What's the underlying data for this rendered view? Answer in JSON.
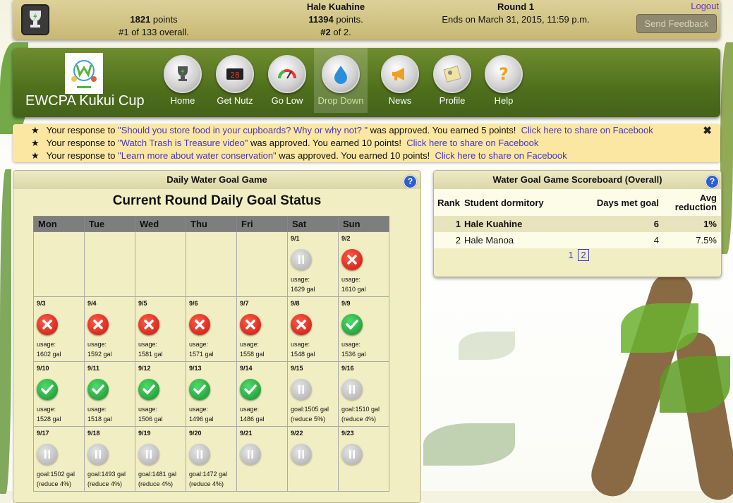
{
  "user": {
    "points": "1821",
    "points_label": "points",
    "rank_overall": "#1",
    "rank_overall_suffix": "of 133 overall."
  },
  "team": {
    "name": "Hale Kuahine",
    "points": "11394",
    "points_label": "points.",
    "rank": "#2",
    "rank_suffix": "of 2."
  },
  "round": {
    "title": "Round 1",
    "ends": "Ends on March 31, 2015, 11:59 p.m."
  },
  "header": {
    "logout": "Logout",
    "feedback": "Send Feedback"
  },
  "brand": {
    "name": "EWCPA Kukui Cup"
  },
  "nav": [
    {
      "label": "Home",
      "icon": "trophy-icon"
    },
    {
      "label": "Get Nutz",
      "icon": "scoreboard-icon"
    },
    {
      "label": "Go Low",
      "icon": "gauge-icon"
    },
    {
      "label": "Drop Down",
      "icon": "water-drop-icon"
    },
    {
      "label": "News",
      "icon": "megaphone-icon"
    },
    {
      "label": "Profile",
      "icon": "profile-card-icon"
    },
    {
      "label": "Help",
      "icon": "question-icon"
    }
  ],
  "notifications": [
    {
      "prefix": "Your response to",
      "link": "\"Should you store food in your cupboards? Why or why not? \"",
      "suffix": "was approved. You earned 5 points!",
      "share": "Click here to share on Facebook"
    },
    {
      "prefix": "Your response to",
      "link": "\"Watch Trash is Treasure video\"",
      "suffix": "was approved. You earned 10 points!",
      "share": "Click here to share on Facebook"
    },
    {
      "prefix": "Your response to",
      "link": "\"Learn more about water conservation\"",
      "suffix": "was approved. You earned 10 points!",
      "share": "Click here to share on Facebook"
    }
  ],
  "water_game": {
    "title": "Daily Water Goal Game",
    "heading": "Current Round Daily Goal Status",
    "days": [
      "Mon",
      "Tue",
      "Wed",
      "Thu",
      "Fri",
      "Sat",
      "Sun"
    ],
    "weeks": [
      [
        {
          "date": "",
          "status": "empty"
        },
        {
          "date": "",
          "status": "empty"
        },
        {
          "date": "",
          "status": "empty"
        },
        {
          "date": "",
          "status": "empty"
        },
        {
          "date": "",
          "status": "empty"
        },
        {
          "date": "9/1",
          "status": "pause",
          "l1": "usage:",
          "l2": "1629 gal"
        },
        {
          "date": "9/2",
          "status": "fail",
          "l1": "usage:",
          "l2": "1610 gal"
        }
      ],
      [
        {
          "date": "9/3",
          "status": "fail",
          "l1": "usage:",
          "l2": "1602 gal"
        },
        {
          "date": "9/4",
          "status": "fail",
          "l1": "usage:",
          "l2": "1592 gal"
        },
        {
          "date": "9/5",
          "status": "fail",
          "l1": "usage:",
          "l2": "1581 gal"
        },
        {
          "date": "9/6",
          "status": "fail",
          "l1": "usage:",
          "l2": "1571 gal"
        },
        {
          "date": "9/7",
          "status": "fail",
          "l1": "usage:",
          "l2": "1558 gal"
        },
        {
          "date": "9/8",
          "status": "fail",
          "l1": "usage:",
          "l2": "1548 gal"
        },
        {
          "date": "9/9",
          "status": "ok",
          "l1": "usage:",
          "l2": "1536 gal"
        }
      ],
      [
        {
          "date": "9/10",
          "status": "ok",
          "l1": "usage:",
          "l2": "1528 gal"
        },
        {
          "date": "9/11",
          "status": "ok",
          "l1": "usage:",
          "l2": "1518 gal"
        },
        {
          "date": "9/12",
          "status": "ok",
          "l1": "usage:",
          "l2": "1506 gal"
        },
        {
          "date": "9/13",
          "status": "ok",
          "l1": "usage:",
          "l2": "1496 gal"
        },
        {
          "date": "9/14",
          "status": "ok",
          "l1": "usage:",
          "l2": "1486 gal"
        },
        {
          "date": "9/15",
          "status": "pause",
          "l1": "goal:1505 gal",
          "l2": "(reduce 5%)"
        },
        {
          "date": "9/16",
          "status": "pause",
          "l1": "goal:1510 gal",
          "l2": "(reduce 4%)"
        }
      ],
      [
        {
          "date": "9/17",
          "status": "pause",
          "l1": "goal:1502 gal",
          "l2": "(reduce 4%)"
        },
        {
          "date": "9/18",
          "status": "pause",
          "l1": "goal:1493 gal",
          "l2": "(reduce 4%)"
        },
        {
          "date": "9/19",
          "status": "pause",
          "l1": "goal:1481 gal",
          "l2": "(reduce 4%)"
        },
        {
          "date": "9/20",
          "status": "pause",
          "l1": "goal:1472 gal",
          "l2": "(reduce 4%)"
        },
        {
          "date": "9/21",
          "status": "pause",
          "l1": "",
          "l2": ""
        },
        {
          "date": "9/22",
          "status": "pause",
          "l1": "",
          "l2": ""
        },
        {
          "date": "9/23",
          "status": "pause",
          "l1": "",
          "l2": ""
        }
      ]
    ]
  },
  "scoreboard": {
    "title": "Water Goal Game Scoreboard (Overall)",
    "columns": {
      "rank": "Rank",
      "dorm": "Student dormitory",
      "days": "Days met goal",
      "avg1": "Avg",
      "avg2": "reduction"
    },
    "rows": [
      {
        "rank": "1",
        "dorm": "Hale Kuahine",
        "days": "6",
        "avg": "1%"
      },
      {
        "rank": "2",
        "dorm": "Hale Manoa",
        "days": "4",
        "avg": "7.5%"
      }
    ],
    "pages": [
      "1",
      "2"
    ]
  },
  "colors": {
    "topbar": "#d3c586",
    "navbar": "#5a7a22",
    "notice_bg": "#fbe7a2",
    "link": "#4636c9",
    "fail": "#d8221a",
    "ok": "#22a83a",
    "help": "#2c5fd6"
  }
}
